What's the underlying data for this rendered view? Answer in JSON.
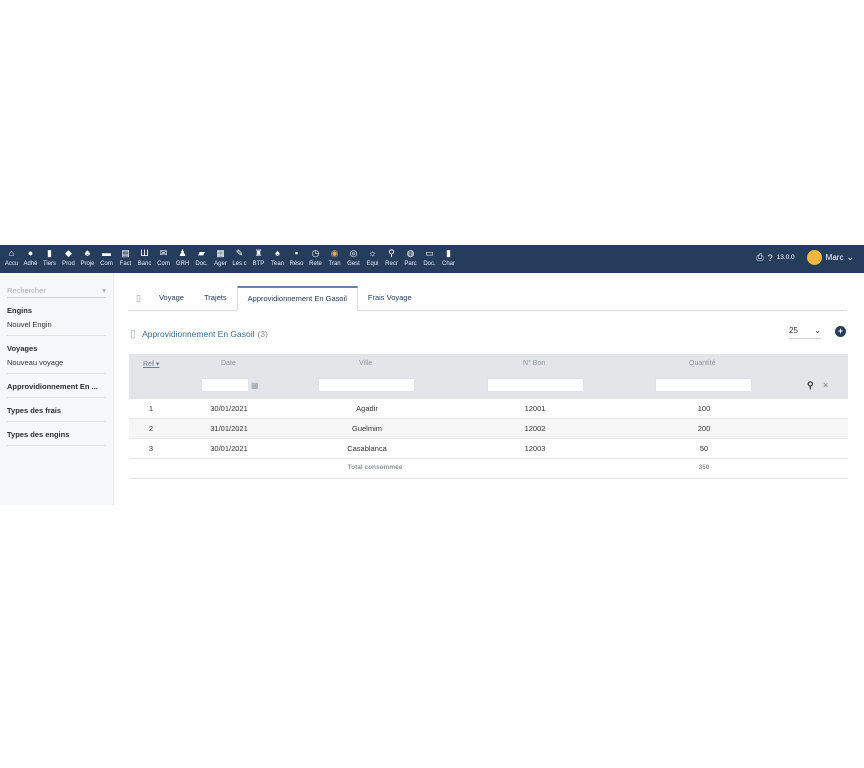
{
  "topbar": {
    "menu": [
      {
        "icon": "home-icon",
        "glyph": "⌂",
        "label": "Accu"
      },
      {
        "icon": "users-icon",
        "glyph": "●",
        "label": "Adhé"
      },
      {
        "icon": "building-icon",
        "glyph": "▮",
        "label": "Tiers"
      },
      {
        "icon": "cube-icon",
        "glyph": "◆",
        "label": "Prod"
      },
      {
        "icon": "sitemap-icon",
        "glyph": "♣",
        "label": "Proje"
      },
      {
        "icon": "suitcase-icon",
        "glyph": "▬",
        "label": "Com"
      },
      {
        "icon": "invoice-icon",
        "glyph": "▤",
        "label": "Fact"
      },
      {
        "icon": "bank-icon",
        "glyph": "Ш",
        "label": "Banc"
      },
      {
        "icon": "mail-icon",
        "glyph": "✉",
        "label": "Com"
      },
      {
        "icon": "person-icon",
        "glyph": "♟",
        "label": "GRH"
      },
      {
        "icon": "folder-icon",
        "glyph": "▰",
        "label": "Doc."
      },
      {
        "icon": "calendar-icon",
        "glyph": "▦",
        "label": "Ager"
      },
      {
        "icon": "wrench-icon",
        "glyph": "✎",
        "label": "Les c"
      },
      {
        "icon": "crane-icon",
        "glyph": "♜",
        "label": "BTP"
      },
      {
        "icon": "team-icon",
        "glyph": "♠",
        "label": "Tean"
      },
      {
        "icon": "book-icon",
        "glyph": "▪",
        "label": "Réso"
      },
      {
        "icon": "clock-icon",
        "glyph": "◷",
        "label": "Rete"
      },
      {
        "icon": "truck-icon",
        "glyph": "◉",
        "label": "Tran"
      },
      {
        "icon": "support-icon",
        "glyph": "◎",
        "label": "Gest"
      },
      {
        "icon": "equipment-icon",
        "glyph": "☼",
        "label": "Équi"
      },
      {
        "icon": "search-person-icon",
        "glyph": "⚲",
        "label": "Recr"
      },
      {
        "icon": "park-icon",
        "glyph": "◍",
        "label": "Parc"
      },
      {
        "icon": "document-icon",
        "glyph": "▭",
        "label": "Doc."
      },
      {
        "icon": "chart-icon",
        "glyph": "▮",
        "label": "Char"
      }
    ],
    "active_index": 17,
    "print_icon": "⎙",
    "help_icon": "?",
    "version": "13.0.0",
    "user_name": "Marc",
    "user_chevron": "⌄"
  },
  "sidebar": {
    "search_placeholder": "Rechercher",
    "search_caret": "▾",
    "blocks": [
      {
        "title": "Engins",
        "links": [
          "Nouvel Engin"
        ]
      },
      {
        "title": "Voyages",
        "links": [
          "Nouveau voyage"
        ]
      },
      {
        "title": "Approvidionnement En ...",
        "links": []
      },
      {
        "title": "Types des frais",
        "links": []
      },
      {
        "title": "Types des engins",
        "links": []
      }
    ]
  },
  "tabs": {
    "file_icon": "▯",
    "items": [
      "Voyage",
      "Trajets",
      "Approvidionnement En Gasoil",
      "Frais Voyage"
    ],
    "active": "Approvidionnement En Gasoil"
  },
  "list": {
    "title_icon": "▯",
    "title": "Approvidionnement En Gasoil",
    "count": "(3)",
    "limit": "25",
    "limit_caret": "⌄",
    "add_icon": "+",
    "headers": {
      "ref": "Ref",
      "sort_caret": "▾",
      "date": "Date",
      "ville": "Ville",
      "bon": "N° Bon",
      "quantite": "Quantité"
    },
    "calendar_icon": "▦",
    "search_icon": "⚲",
    "clear_icon": "×",
    "rows": [
      {
        "ref": "1",
        "date": "30/01/2021",
        "ville": "Agadir",
        "bon": "12001",
        "quantite": "100"
      },
      {
        "ref": "2",
        "date": "31/01/2021",
        "ville": "Guelmim",
        "bon": "12002",
        "quantite": "200"
      },
      {
        "ref": "3",
        "date": "30/01/2021",
        "ville": "Casablanca",
        "bon": "12003",
        "quantite": "50"
      }
    ],
    "total_label": "Total consommée",
    "total_value": "350"
  }
}
